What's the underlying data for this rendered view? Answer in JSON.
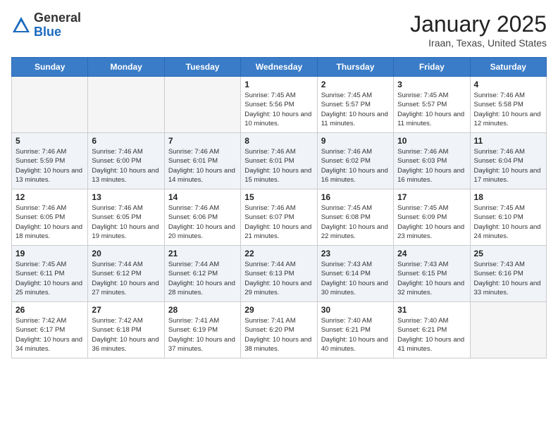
{
  "header": {
    "logo_general": "General",
    "logo_blue": "Blue",
    "title": "January 2025",
    "location": "Iraan, Texas, United States"
  },
  "weekdays": [
    "Sunday",
    "Monday",
    "Tuesday",
    "Wednesday",
    "Thursday",
    "Friday",
    "Saturday"
  ],
  "weeks": [
    [
      {
        "day": "",
        "empty": true
      },
      {
        "day": "",
        "empty": true
      },
      {
        "day": "",
        "empty": true
      },
      {
        "day": "1",
        "sunrise": "Sunrise: 7:45 AM",
        "sunset": "Sunset: 5:56 PM",
        "daylight": "Daylight: 10 hours and 10 minutes."
      },
      {
        "day": "2",
        "sunrise": "Sunrise: 7:45 AM",
        "sunset": "Sunset: 5:57 PM",
        "daylight": "Daylight: 10 hours and 11 minutes."
      },
      {
        "day": "3",
        "sunrise": "Sunrise: 7:45 AM",
        "sunset": "Sunset: 5:57 PM",
        "daylight": "Daylight: 10 hours and 11 minutes."
      },
      {
        "day": "4",
        "sunrise": "Sunrise: 7:46 AM",
        "sunset": "Sunset: 5:58 PM",
        "daylight": "Daylight: 10 hours and 12 minutes."
      }
    ],
    [
      {
        "day": "5",
        "sunrise": "Sunrise: 7:46 AM",
        "sunset": "Sunset: 5:59 PM",
        "daylight": "Daylight: 10 hours and 13 minutes."
      },
      {
        "day": "6",
        "sunrise": "Sunrise: 7:46 AM",
        "sunset": "Sunset: 6:00 PM",
        "daylight": "Daylight: 10 hours and 13 minutes."
      },
      {
        "day": "7",
        "sunrise": "Sunrise: 7:46 AM",
        "sunset": "Sunset: 6:01 PM",
        "daylight": "Daylight: 10 hours and 14 minutes."
      },
      {
        "day": "8",
        "sunrise": "Sunrise: 7:46 AM",
        "sunset": "Sunset: 6:01 PM",
        "daylight": "Daylight: 10 hours and 15 minutes."
      },
      {
        "day": "9",
        "sunrise": "Sunrise: 7:46 AM",
        "sunset": "Sunset: 6:02 PM",
        "daylight": "Daylight: 10 hours and 16 minutes."
      },
      {
        "day": "10",
        "sunrise": "Sunrise: 7:46 AM",
        "sunset": "Sunset: 6:03 PM",
        "daylight": "Daylight: 10 hours and 16 minutes."
      },
      {
        "day": "11",
        "sunrise": "Sunrise: 7:46 AM",
        "sunset": "Sunset: 6:04 PM",
        "daylight": "Daylight: 10 hours and 17 minutes."
      }
    ],
    [
      {
        "day": "12",
        "sunrise": "Sunrise: 7:46 AM",
        "sunset": "Sunset: 6:05 PM",
        "daylight": "Daylight: 10 hours and 18 minutes."
      },
      {
        "day": "13",
        "sunrise": "Sunrise: 7:46 AM",
        "sunset": "Sunset: 6:05 PM",
        "daylight": "Daylight: 10 hours and 19 minutes."
      },
      {
        "day": "14",
        "sunrise": "Sunrise: 7:46 AM",
        "sunset": "Sunset: 6:06 PM",
        "daylight": "Daylight: 10 hours and 20 minutes."
      },
      {
        "day": "15",
        "sunrise": "Sunrise: 7:46 AM",
        "sunset": "Sunset: 6:07 PM",
        "daylight": "Daylight: 10 hours and 21 minutes."
      },
      {
        "day": "16",
        "sunrise": "Sunrise: 7:45 AM",
        "sunset": "Sunset: 6:08 PM",
        "daylight": "Daylight: 10 hours and 22 minutes."
      },
      {
        "day": "17",
        "sunrise": "Sunrise: 7:45 AM",
        "sunset": "Sunset: 6:09 PM",
        "daylight": "Daylight: 10 hours and 23 minutes."
      },
      {
        "day": "18",
        "sunrise": "Sunrise: 7:45 AM",
        "sunset": "Sunset: 6:10 PM",
        "daylight": "Daylight: 10 hours and 24 minutes."
      }
    ],
    [
      {
        "day": "19",
        "sunrise": "Sunrise: 7:45 AM",
        "sunset": "Sunset: 6:11 PM",
        "daylight": "Daylight: 10 hours and 25 minutes."
      },
      {
        "day": "20",
        "sunrise": "Sunrise: 7:44 AM",
        "sunset": "Sunset: 6:12 PM",
        "daylight": "Daylight: 10 hours and 27 minutes."
      },
      {
        "day": "21",
        "sunrise": "Sunrise: 7:44 AM",
        "sunset": "Sunset: 6:12 PM",
        "daylight": "Daylight: 10 hours and 28 minutes."
      },
      {
        "day": "22",
        "sunrise": "Sunrise: 7:44 AM",
        "sunset": "Sunset: 6:13 PM",
        "daylight": "Daylight: 10 hours and 29 minutes."
      },
      {
        "day": "23",
        "sunrise": "Sunrise: 7:43 AM",
        "sunset": "Sunset: 6:14 PM",
        "daylight": "Daylight: 10 hours and 30 minutes."
      },
      {
        "day": "24",
        "sunrise": "Sunrise: 7:43 AM",
        "sunset": "Sunset: 6:15 PM",
        "daylight": "Daylight: 10 hours and 32 minutes."
      },
      {
        "day": "25",
        "sunrise": "Sunrise: 7:43 AM",
        "sunset": "Sunset: 6:16 PM",
        "daylight": "Daylight: 10 hours and 33 minutes."
      }
    ],
    [
      {
        "day": "26",
        "sunrise": "Sunrise: 7:42 AM",
        "sunset": "Sunset: 6:17 PM",
        "daylight": "Daylight: 10 hours and 34 minutes."
      },
      {
        "day": "27",
        "sunrise": "Sunrise: 7:42 AM",
        "sunset": "Sunset: 6:18 PM",
        "daylight": "Daylight: 10 hours and 36 minutes."
      },
      {
        "day": "28",
        "sunrise": "Sunrise: 7:41 AM",
        "sunset": "Sunset: 6:19 PM",
        "daylight": "Daylight: 10 hours and 37 minutes."
      },
      {
        "day": "29",
        "sunrise": "Sunrise: 7:41 AM",
        "sunset": "Sunset: 6:20 PM",
        "daylight": "Daylight: 10 hours and 38 minutes."
      },
      {
        "day": "30",
        "sunrise": "Sunrise: 7:40 AM",
        "sunset": "Sunset: 6:21 PM",
        "daylight": "Daylight: 10 hours and 40 minutes."
      },
      {
        "day": "31",
        "sunrise": "Sunrise: 7:40 AM",
        "sunset": "Sunset: 6:21 PM",
        "daylight": "Daylight: 10 hours and 41 minutes."
      },
      {
        "day": "",
        "empty": true
      }
    ]
  ]
}
